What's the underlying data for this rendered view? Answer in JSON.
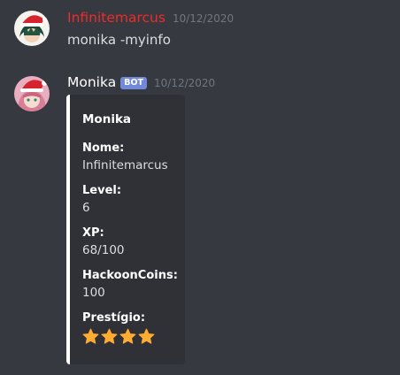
{
  "messages": [
    {
      "username": "Infinitemarcus",
      "timestamp": "10/12/2020",
      "content": "monika -myinfo",
      "avatar_icon": "green-hair-santa-avatar",
      "name_color": "#ed2b2b"
    },
    {
      "username": "Monika",
      "badge": "BOT",
      "timestamp": "10/12/2020",
      "avatar_icon": "pink-hair-santa-avatar",
      "name_color": "#ffffff"
    }
  ],
  "embed": {
    "accent_color": "#ffffff",
    "author": "Monika",
    "fields": [
      {
        "name": "Nome:",
        "value": "Infinitemarcus"
      },
      {
        "name": "Level:",
        "value": "6"
      },
      {
        "name": "XP:",
        "value": "68/100"
      },
      {
        "name": "HackoonCoins:",
        "value": "100"
      }
    ],
    "prestige": {
      "name": "Prestígio:",
      "stars": 4,
      "star_icon": "star-icon",
      "star_color": "#ffac33"
    }
  }
}
